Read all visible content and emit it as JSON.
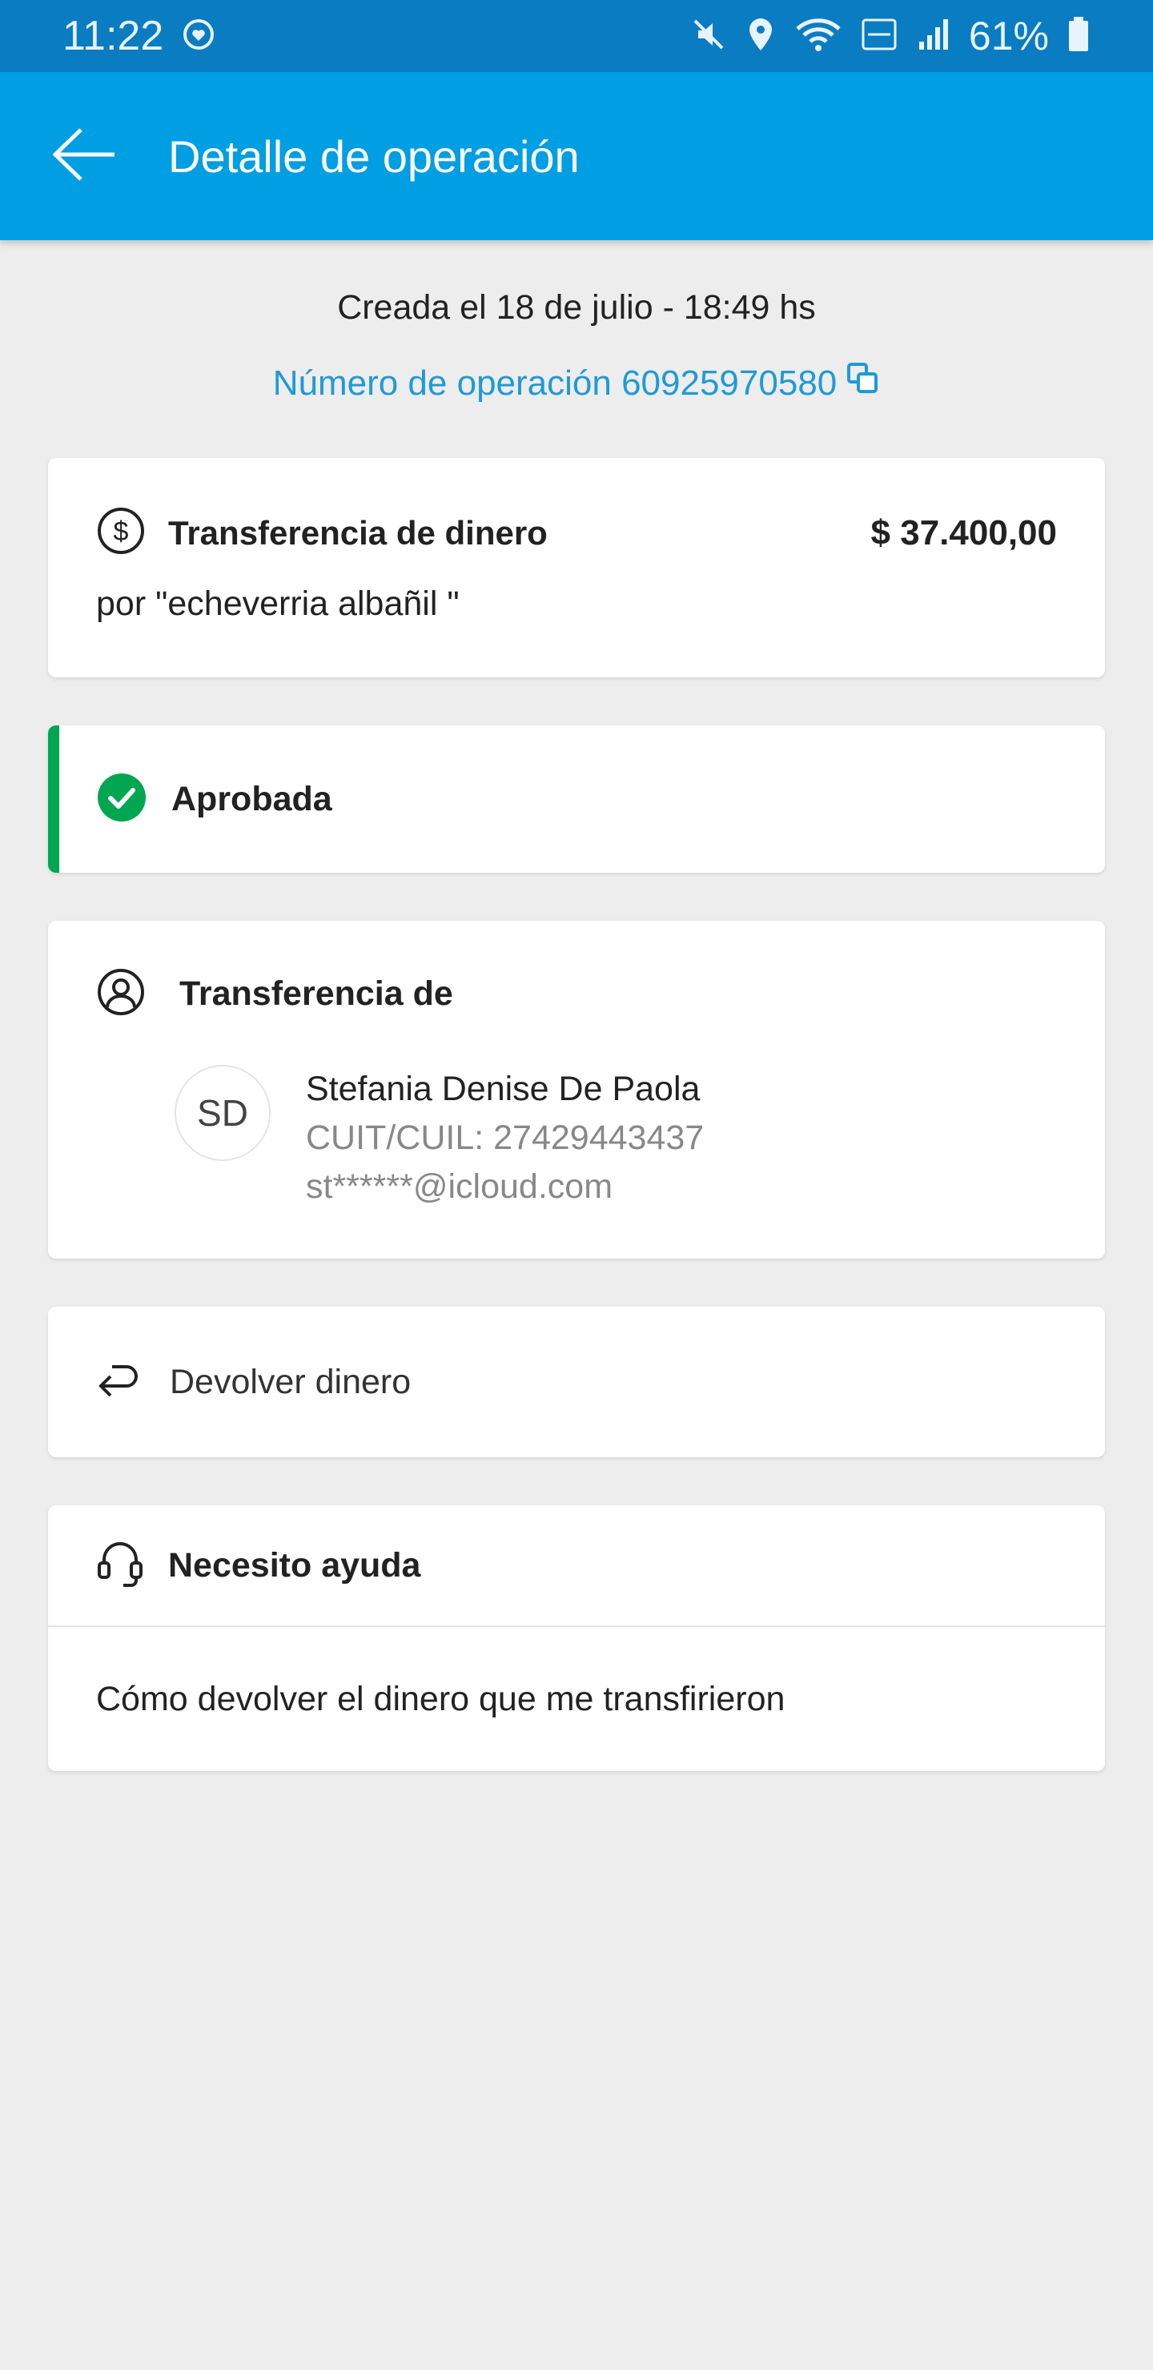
{
  "status_bar": {
    "time": "11:22",
    "battery": "61%"
  },
  "app_bar": {
    "title": "Detalle de operación"
  },
  "header": {
    "created": "Creada el 18 de julio - 18:49 hs",
    "operation_number": "Número de operación 60925970580"
  },
  "transaction": {
    "title": "Transferencia de dinero",
    "amount": "$ 37.400,00",
    "description": "por \"echeverria albañil \""
  },
  "status": {
    "label": "Aprobada",
    "color": "#00a650"
  },
  "sender": {
    "section_title": "Transferencia de",
    "initials": "SD",
    "name": "Stefania Denise De Paola",
    "cuit": "CUIT/CUIL: 27429443437",
    "email": "st******@icloud.com"
  },
  "return_money": {
    "label": "Devolver dinero"
  },
  "help": {
    "title": "Necesito ayuda",
    "item": "Cómo devolver el dinero que me transfirieron"
  },
  "colors": {
    "status_bar": "#0a7cc2",
    "app_bar": "#009ee3",
    "link": "#1f9ad6",
    "background": "#ededed"
  }
}
